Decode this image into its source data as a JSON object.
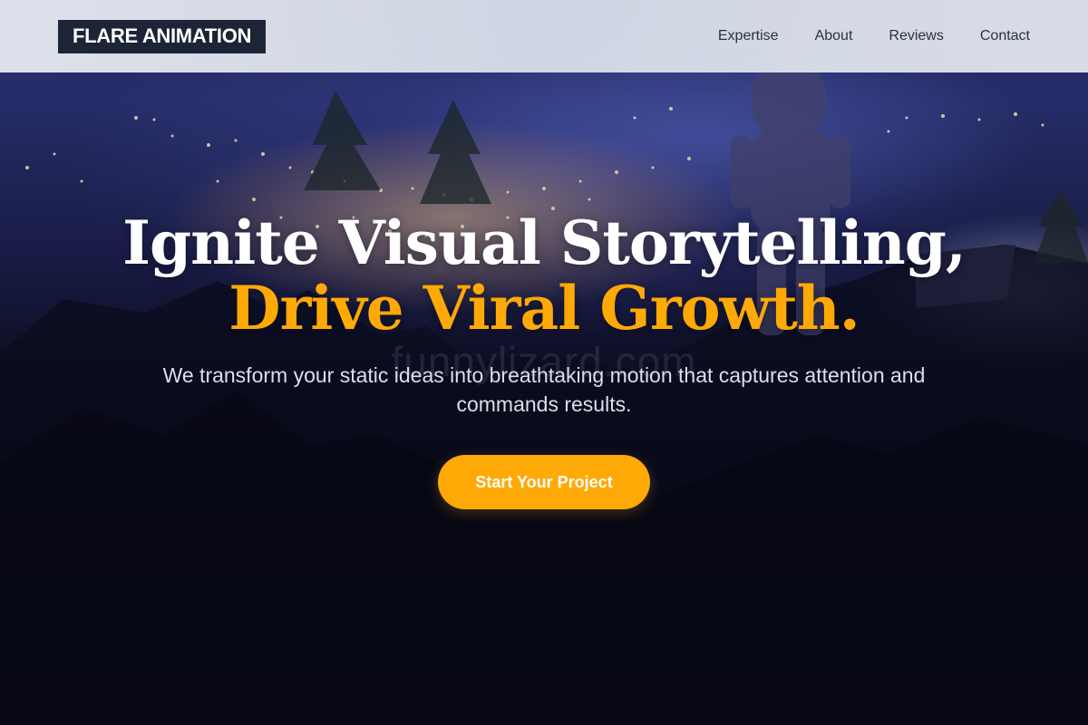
{
  "navbar": {
    "logo": "FLARE ANIMATION",
    "links": [
      "Expertise",
      "About",
      "Reviews",
      "Contact"
    ]
  },
  "hero": {
    "headline_line1": "Ignite Visual Storytelling,",
    "headline_line2": "Drive Viral Growth.",
    "subtitle": "We transform your static ideas into breathtaking motion that captures attention and commands results.",
    "cta_label": "Start Your Project",
    "watermark": "funnylizard.com",
    "background_icon": "night-city-hero-image"
  },
  "colors": {
    "accent": "#ffa907",
    "logo_bg": "#1c2536",
    "nav_text": "#2a3140",
    "headline_white": "#ffffff"
  }
}
